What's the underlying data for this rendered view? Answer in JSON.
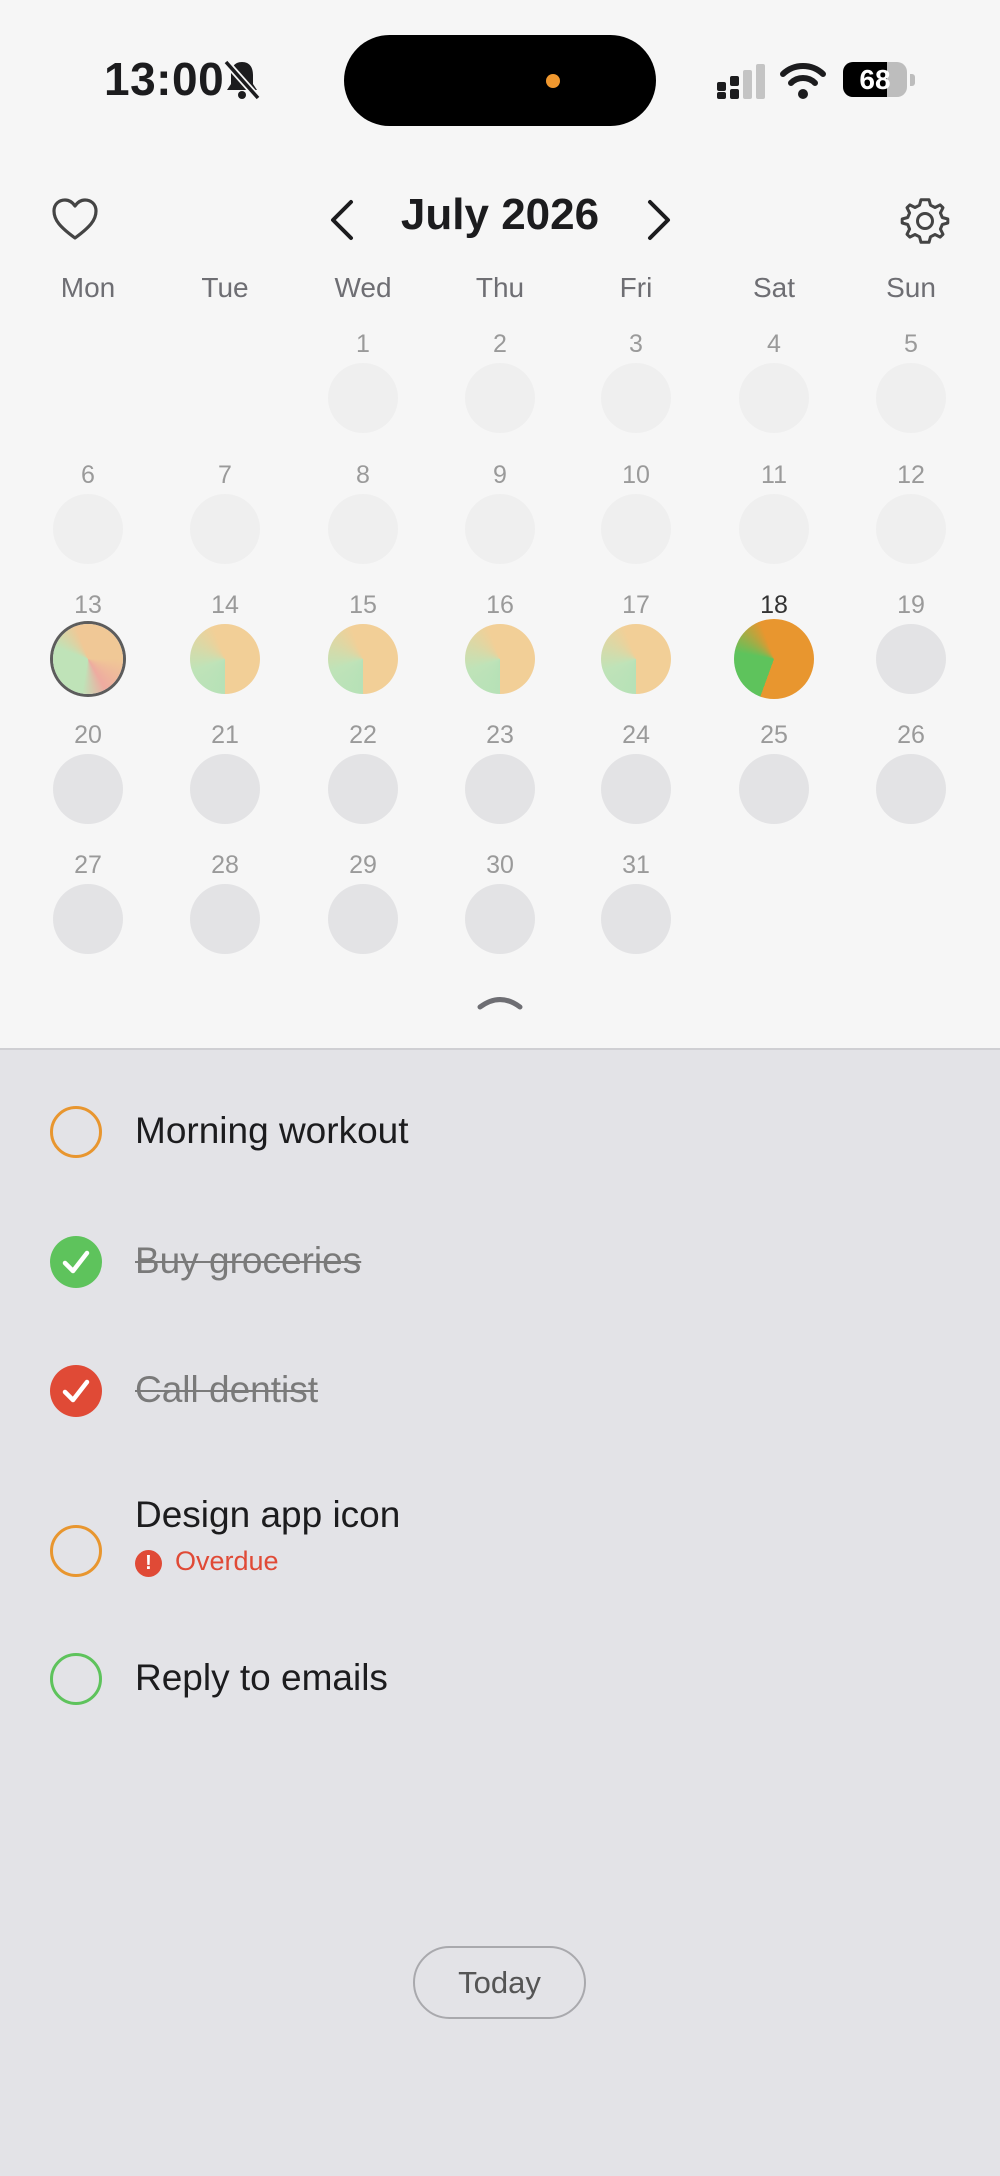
{
  "status_bar": {
    "time": "13:00",
    "battery_percent": 68,
    "battery_label": "68"
  },
  "calendar": {
    "month_title": "July 2026",
    "weekdays": [
      "Mon",
      "Tue",
      "Wed",
      "Thu",
      "Fri",
      "Sat",
      "Sun"
    ],
    "days": {
      "d1": "1",
      "d2": "2",
      "d3": "3",
      "d4": "4",
      "d5": "5",
      "d6": "6",
      "d7": "7",
      "d8": "8",
      "d9": "9",
      "d10": "10",
      "d11": "11",
      "d12": "12",
      "d13": "13",
      "d14": "14",
      "d15": "15",
      "d16": "16",
      "d17": "17",
      "d18": "18",
      "d19": "19",
      "d20": "20",
      "d21": "21",
      "d22": "22",
      "d23": "23",
      "d24": "24",
      "d25": "25",
      "d26": "26",
      "d27": "27",
      "d28": "28",
      "d29": "29",
      "d30": "30",
      "d31": "31"
    },
    "today": "13",
    "selected": "18",
    "colors": {
      "green": "#5ec35c",
      "orange": "#e8962f",
      "red": "#e04a36"
    }
  },
  "tasks": [
    {
      "title": "Morning workout",
      "state": "open",
      "color": "#e8962f"
    },
    {
      "title": "Buy groceries",
      "state": "done",
      "color": "#5ec35c"
    },
    {
      "title": "Call dentist",
      "state": "done",
      "color": "#e04a36"
    },
    {
      "title": "Design app icon",
      "state": "open",
      "color": "#e8962f",
      "status": "Overdue"
    },
    {
      "title": "Reply to emails",
      "state": "open",
      "color": "#5ec35c"
    }
  ],
  "today_button": "Today"
}
